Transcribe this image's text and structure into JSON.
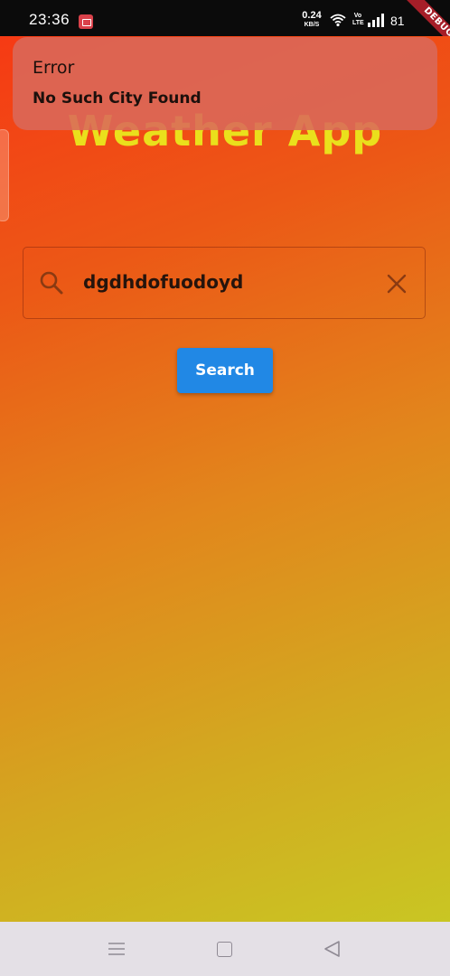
{
  "status_bar": {
    "time": "23:36",
    "net_speed_value": "0.24",
    "net_speed_unit": "KB/S",
    "volte_top": "Vo",
    "volte_bottom": "LTE",
    "battery": "81"
  },
  "debug_banner": {
    "label": "DEBUG"
  },
  "app": {
    "title": "Weather App",
    "search": {
      "value": "dgdhdofuodoyd"
    },
    "search_button_label": "Search",
    "gradient_colors": [
      "#f63a14",
      "#e2861c",
      "#c9c623"
    ]
  },
  "snackbar": {
    "title": "Error",
    "message": "No Such City Found"
  },
  "nav_bar": {
    "icons": [
      "menu-icon",
      "home-square-icon",
      "back-triangle-icon"
    ]
  },
  "colors": {
    "title_yellow": "#eae01c",
    "button_blue": "#2188e5",
    "snackbar_bg": "#da695a"
  }
}
